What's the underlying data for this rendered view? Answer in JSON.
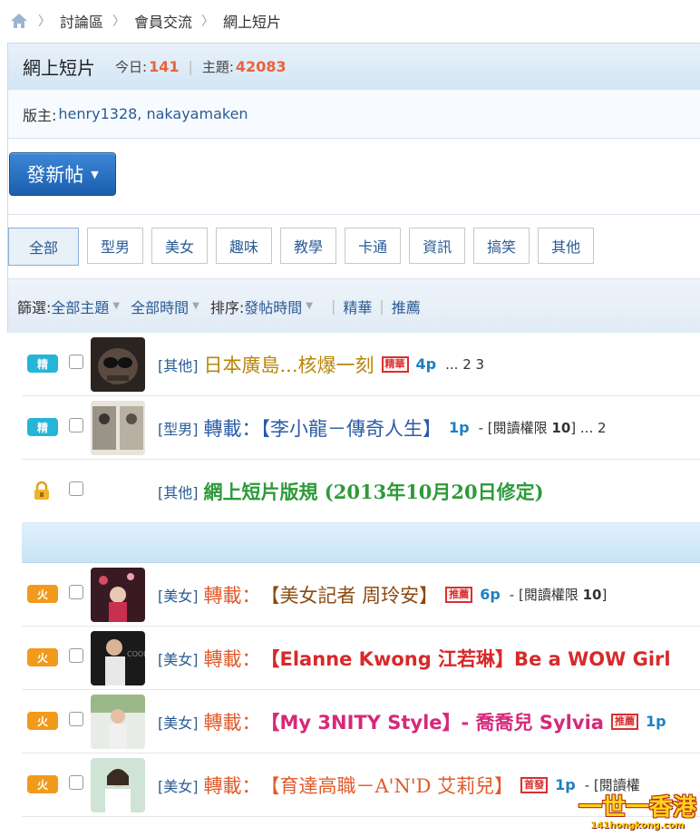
{
  "breadcrumb": {
    "items": [
      "討論區",
      "會員交流",
      "網上短片"
    ]
  },
  "forum": {
    "name": "網上短片",
    "today_label": "今日:",
    "today_count": "141",
    "topics_label": "主題:",
    "topics_count": "42083",
    "moderators_label": "版主:",
    "moderators": "henry1328, nakayamaken"
  },
  "new_post": {
    "label": "發新帖"
  },
  "tabs": [
    "全部",
    "型男",
    "美女",
    "趣味",
    "教學",
    "卡通",
    "資訊",
    "搞笑",
    "其他"
  ],
  "filter": {
    "label": "篩選:",
    "all_topics": "全部主題",
    "all_time": "全部時間",
    "sort_label": "排序:",
    "sort_value": "發帖時間",
    "digest": "精華",
    "recommend": "推薦"
  },
  "threads": [
    {
      "icon": "精",
      "category": "[其他]",
      "title": "日本廣島...核爆一刻",
      "badge": "精華",
      "pages": "4p",
      "extra": "... 2  3"
    },
    {
      "icon": "精",
      "category": "[型男]",
      "title": "轉載：【李小龍－傳奇人生】",
      "pages": "1p",
      "extra_prefix": "- [閱讀權限 ",
      "extra_num": "10",
      "extra_suffix": "] ... 2"
    },
    {
      "icon": "lock",
      "category": "[其他]",
      "title": "網上短片版規 (2013年10月20日修定)"
    },
    {
      "icon": "火",
      "category": "[美女]",
      "title_prefix": "轉載：",
      "title": "【美女記者 周玲安】",
      "badge": "推薦",
      "pages": "6p",
      "extra_prefix": "- [閱讀權限 ",
      "extra_num": "10",
      "extra_suffix": "]"
    },
    {
      "icon": "火",
      "category": "[美女]",
      "title_prefix": "轉載：",
      "title": "【Elanne Kwong 江若琳】Be a WOW Girl"
    },
    {
      "icon": "火",
      "category": "[美女]",
      "title_prefix": "轉載：",
      "title": "【My 3NITY Style】- 喬喬兒 Sylvia",
      "badge": "推薦",
      "pages": "1p"
    },
    {
      "icon": "火",
      "category": "[美女]",
      "title_prefix": "轉載：",
      "title": "【育達高職－A'N'D 艾莉兒】",
      "badge": "首發",
      "pages": "1p",
      "extra_prefix": "- [閱讀權"
    }
  ],
  "watermark": {
    "top": "一世一香港",
    "sub": "141hongkong.com"
  },
  "colors": {
    "accent": "#1b5fae",
    "stat": "#e8643a",
    "link": "#2a5b94"
  }
}
